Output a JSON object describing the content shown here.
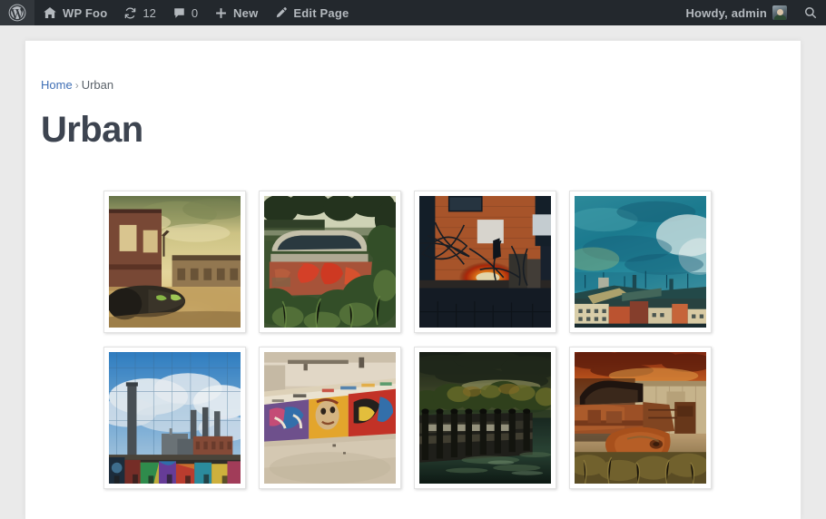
{
  "adminbar": {
    "logo_icon": "wordpress-logo-icon",
    "site": {
      "icon": "home-icon",
      "label": "WP Foo"
    },
    "updates": {
      "icon": "updates-icon",
      "count": "12"
    },
    "comments": {
      "icon": "comment-bubble-icon",
      "count": "0"
    },
    "new": {
      "icon": "plus-icon",
      "label": "New"
    },
    "edit": {
      "icon": "pencil-icon",
      "label": "Edit Page"
    },
    "howdy": "Howdy, admin",
    "avatar_icon": "user-avatar",
    "search_icon": "search-icon"
  },
  "breadcrumb": {
    "home": "Home",
    "separator": "›",
    "current": "Urban"
  },
  "page": {
    "title": "Urban"
  },
  "gallery": {
    "items": [
      {
        "name": "brick-warehouse-graffiti-tank",
        "alt": "Brick warehouse with golden sky and graffiti tank"
      },
      {
        "name": "abandoned-red-van-overgrown",
        "alt": "Rusted red van overgrown with vegetation"
      },
      {
        "name": "barbed-wire-glowing-light",
        "alt": "Barbed wire against brick wall with glowing orange light"
      },
      {
        "name": "teal-sky-city-skyline",
        "alt": "Teal cloudy sky over colourful city rooftops"
      },
      {
        "name": "power-station-chimneys-graffiti",
        "alt": "Power station chimneys with blue sky and graffiti"
      },
      {
        "name": "graffiti-mural-wall",
        "alt": "Colourful graffiti mural on interior wall"
      },
      {
        "name": "wooden-pier-stormy-water",
        "alt": "Dark wooden pier over water under stormy sky"
      },
      {
        "name": "rusted-abandoned-truck",
        "alt": "Rusted abandoned truck in orange light"
      }
    ]
  },
  "colors": {
    "adminbar_bg": "#23282d",
    "body_bg": "#eaeaea",
    "card_bg": "#ffffff",
    "link": "#3f6fb5",
    "title": "#3d4450"
  }
}
